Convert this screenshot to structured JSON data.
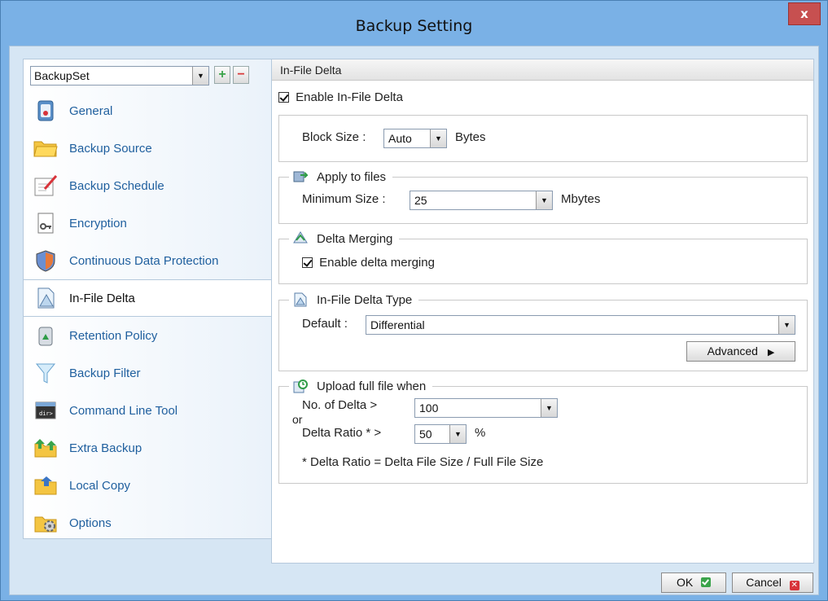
{
  "window": {
    "title": "Backup Setting",
    "close_label": "x"
  },
  "sidebar": {
    "backup_set": "BackupSet",
    "add_label": "+",
    "remove_label": "−",
    "items": [
      {
        "label": "General",
        "icon": "general-icon"
      },
      {
        "label": "Backup Source",
        "icon": "folder-icon"
      },
      {
        "label": "Backup Schedule",
        "icon": "schedule-icon"
      },
      {
        "label": "Encryption",
        "icon": "key-icon"
      },
      {
        "label": "Continuous Data Protection",
        "icon": "shield-icon"
      },
      {
        "label": "In-File Delta",
        "icon": "delta-icon",
        "active": true
      },
      {
        "label": "Retention Policy",
        "icon": "recycle-bin-icon"
      },
      {
        "label": "Backup Filter",
        "icon": "filter-icon"
      },
      {
        "label": "Command Line Tool",
        "icon": "terminal-icon"
      },
      {
        "label": "Extra Backup",
        "icon": "extra-backup-icon"
      },
      {
        "label": "Local Copy",
        "icon": "local-copy-icon"
      },
      {
        "label": "Options",
        "icon": "options-icon"
      }
    ]
  },
  "main": {
    "header": "In-File Delta",
    "enable_label": "Enable In-File Delta",
    "block_size": {
      "label": "Block Size :",
      "value": "Auto",
      "unit": "Bytes"
    },
    "apply_to_files": {
      "title": "Apply to files",
      "label": "Minimum Size :",
      "value": "25",
      "unit": "Mbytes"
    },
    "delta_merging": {
      "title": "Delta Merging",
      "checkbox_label": "Enable delta merging"
    },
    "delta_type": {
      "title": "In-File Delta Type",
      "label": "Default :",
      "value": "Differential",
      "advanced_label": "Advanced"
    },
    "upload_full": {
      "title": "Upload full file when",
      "no_of_delta_label": "No. of Delta >",
      "no_of_delta_value": "100",
      "or_label": "or",
      "ratio_label": "Delta Ratio * >",
      "ratio_value": "50",
      "ratio_unit": "%",
      "note": "* Delta Ratio = Delta File Size / Full File Size"
    }
  },
  "footer": {
    "ok_label": "OK",
    "cancel_label": "Cancel"
  }
}
